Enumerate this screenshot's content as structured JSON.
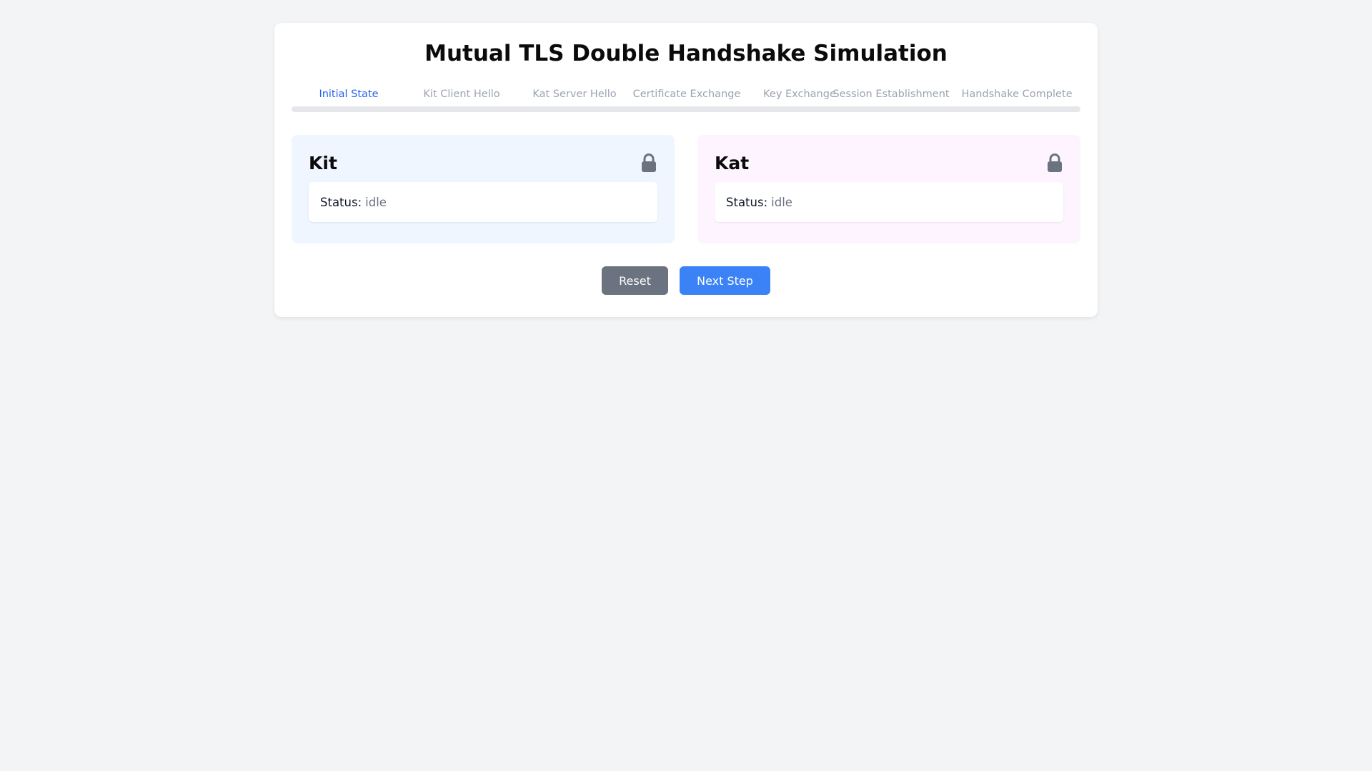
{
  "title": "Mutual TLS Double Handshake Simulation",
  "steps": [
    {
      "label": "Initial State",
      "active": true
    },
    {
      "label": "Kit Client Hello",
      "active": false
    },
    {
      "label": "Kat Server Hello",
      "active": false
    },
    {
      "label": "Certificate Exchange",
      "active": false
    },
    {
      "label": "Key Exchange",
      "active": false
    },
    {
      "label": "Session Establishment",
      "active": false
    },
    {
      "label": "Handshake Complete",
      "active": false
    }
  ],
  "progress_fraction": 0,
  "kit": {
    "name": "Kit",
    "status_label": "Status:",
    "status_value": "idle",
    "icon": "lock-icon"
  },
  "kat": {
    "name": "Kat",
    "status_label": "Status:",
    "status_value": "idle",
    "icon": "lock-icon"
  },
  "controls": {
    "reset_label": "Reset",
    "next_label": "Next Step"
  },
  "colors": {
    "accent": "#3b82f6",
    "active_step": "#2563eb",
    "reset": "#6b7280",
    "kit_panel": "#eff6ff",
    "kat_panel": "#fdf4ff"
  }
}
